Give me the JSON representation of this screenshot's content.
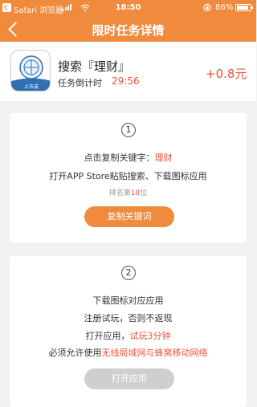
{
  "status_bar": {
    "app_label": "Safari 浏览器",
    "time": "18:50",
    "battery_text": "86%"
  },
  "nav": {
    "title": "限时任务详情"
  },
  "task": {
    "app_name": "搜索『理财』",
    "countdown_label": "任务倒计时",
    "countdown_value": "29:56",
    "reward": "+0.8元",
    "logo_caption": "上市成"
  },
  "step1": {
    "number": "1",
    "copy_prefix": "点击复制关键字：",
    "keyword": "理财",
    "instruction": "打开APP Store粘贴搜索、下载图标应用",
    "rank_prefix": "排名第",
    "rank_value": "18",
    "rank_suffix": "位",
    "copy_button": "复制关键词"
  },
  "step2": {
    "number": "2",
    "line1": "下载图标对应应用",
    "line2": "注册试玩，否则不返现",
    "line3_prefix": "打开应用，",
    "line3_highlight": "试玩3分钟",
    "line4_prefix": "必须允许使用",
    "line4_highlight": "无线局域网与蜂窝移动网络",
    "open_button": "打开应用"
  },
  "colors": {
    "accent": "#f08a3c",
    "highlight": "#e8543a",
    "disabled": "#cfcfcf",
    "background": "#f2f2f2"
  }
}
